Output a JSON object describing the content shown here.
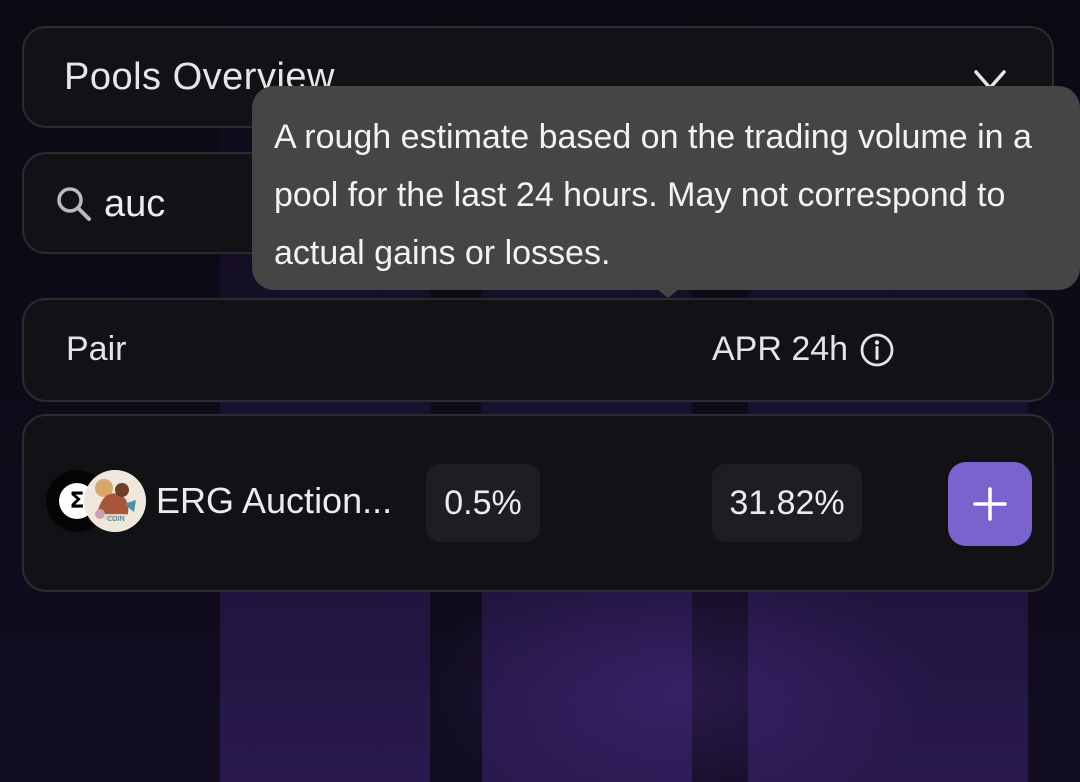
{
  "overview": {
    "title": "Pools Overview",
    "chevron_icon": "chevron-down-icon"
  },
  "search": {
    "icon": "search-icon",
    "value": "auc"
  },
  "table": {
    "col_pair": "Pair",
    "col_apr": "APR 24h",
    "info_icon": "info-icon"
  },
  "pool": {
    "token_a_icon": "erg-token-icon",
    "token_a_symbol": "Σ",
    "token_b_icon": "auction-coin-token-icon",
    "token_b_text": "COIN",
    "pair_name": "ERG Auction...",
    "fee": "0.5%",
    "apr": "31.82%",
    "add_icon": "plus-icon"
  },
  "tooltip": {
    "text": "A rough estimate based on the trading volume in a pool for the last 24 hours. May not correspond to actual gains or losses."
  },
  "colors": {
    "accent": "#7a63cc",
    "panel": "#121216",
    "tooltip": "#454545"
  }
}
